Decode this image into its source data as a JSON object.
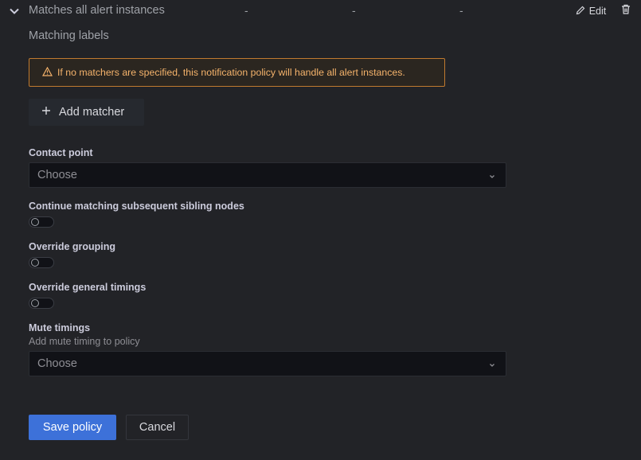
{
  "row": {
    "title": "Matches all alert instances",
    "col1": "-",
    "col2": "-",
    "col3": "-",
    "edit_label": "Edit",
    "icons": {
      "expand": "chevron-down-icon",
      "edit": "pencil-icon",
      "delete": "trash-icon"
    }
  },
  "matchers": {
    "heading": "Matching labels",
    "warning": "If no matchers are specified, this notification policy will handle all alert instances.",
    "warning_icon": "warning-triangle-icon",
    "add_label": "Add matcher",
    "add_icon": "plus-icon"
  },
  "contact_point": {
    "label": "Contact point",
    "placeholder": "Choose"
  },
  "continue_matching": {
    "label": "Continue matching subsequent sibling nodes",
    "enabled": false
  },
  "override_grouping": {
    "label": "Override grouping",
    "enabled": false
  },
  "override_timings": {
    "label": "Override general timings",
    "enabled": false
  },
  "mute_timings": {
    "label": "Mute timings",
    "description": "Add mute timing to policy",
    "placeholder": "Choose"
  },
  "actions": {
    "save_label": "Save policy",
    "cancel_label": "Cancel"
  },
  "colors": {
    "primary": "#3d71d9",
    "warning_border": "#c07a2f",
    "warning_text": "#f5b36b"
  }
}
